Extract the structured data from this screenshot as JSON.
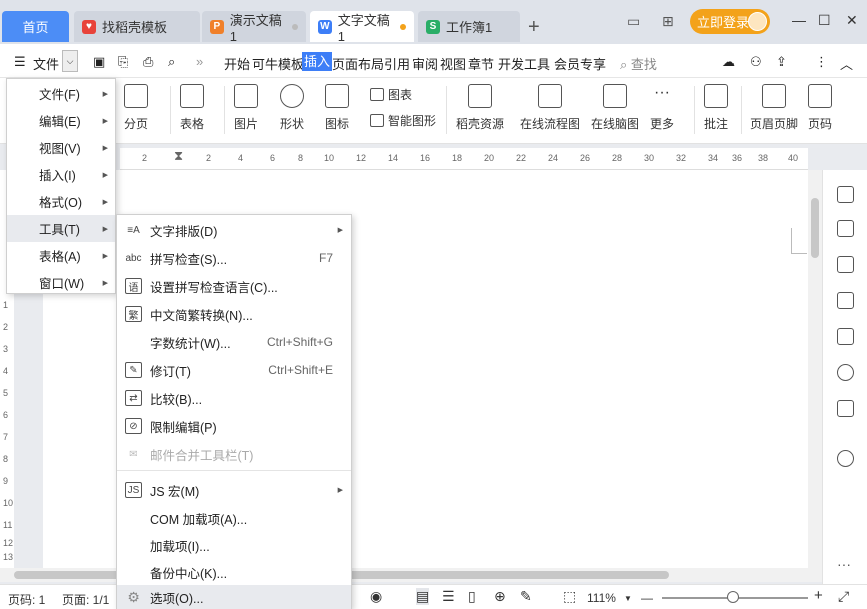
{
  "tabs": {
    "home": "首页",
    "items": [
      {
        "label": "找稻壳模板",
        "icon_letter": "",
        "color": "#e8433a"
      },
      {
        "label": "演示文稿1",
        "icon_letter": "P",
        "color": "#f0802a"
      },
      {
        "label": "文字文稿1",
        "icon_letter": "W",
        "color": "#3d7ef7"
      },
      {
        "label": "工作簿1",
        "icon_letter": "S",
        "color": "#2aae67"
      }
    ],
    "add": "+"
  },
  "login": {
    "label": "立即登录"
  },
  "window": {
    "minimize": "—",
    "maximize": "☐",
    "close": "✕"
  },
  "menubar": {
    "file": "文件",
    "items": [
      "开始",
      "可牛模板",
      "插入",
      "页面布局",
      "引用",
      "审阅",
      "视图",
      "章节",
      "开发工具",
      "会员专享"
    ],
    "search": "查找"
  },
  "ribbon": {
    "page_split": "分页",
    "table": "表格",
    "picture": "图片",
    "shape": "形状",
    "icons": "图标",
    "chart": "图表",
    "smart_shape": "智能图形",
    "docer": "稻壳资源",
    "flowchart": "在线流程图",
    "mindmap": "在线脑图",
    "more": "更多",
    "comment": "批注",
    "header_footer": "页眉页脚",
    "page_num": "页码"
  },
  "ruler": {
    "h_ticks": [
      "2",
      "2",
      "4",
      "6",
      "8",
      "10",
      "12",
      "14",
      "16",
      "18",
      "20",
      "22",
      "24",
      "26",
      "28",
      "30",
      "32",
      "34",
      "36",
      "38",
      "40"
    ],
    "v_ticks": [
      "1",
      "2",
      "3",
      "4",
      "5",
      "6",
      "7",
      "8",
      "9",
      "10",
      "11",
      "12",
      "13"
    ]
  },
  "menu1": [
    {
      "label": "文件(F)"
    },
    {
      "label": "编辑(E)"
    },
    {
      "label": "视图(V)"
    },
    {
      "label": "插入(I)"
    },
    {
      "label": "格式(O)"
    },
    {
      "label": "工具(T)"
    },
    {
      "label": "表格(A)"
    },
    {
      "label": "窗口(W)"
    }
  ],
  "menu2": [
    {
      "label": "文字排版(D)",
      "shortcut": "",
      "icon": "≡A"
    },
    {
      "label": "拼写检查(S)...",
      "shortcut": "F7",
      "icon": "abc"
    },
    {
      "label": "设置拼写检查语言(C)...",
      "shortcut": "",
      "icon": "语"
    },
    {
      "label": "中文简繁转换(N)...",
      "shortcut": "",
      "icon": "繁"
    },
    {
      "label": "字数统计(W)...",
      "shortcut": "Ctrl+Shift+G",
      "icon": ""
    },
    {
      "label": "修订(T)",
      "shortcut": "Ctrl+Shift+E",
      "icon": "✎"
    },
    {
      "label": "比较(B)...",
      "shortcut": "",
      "icon": "⇄"
    },
    {
      "label": "限制编辑(P)",
      "shortcut": "",
      "icon": "⊘"
    },
    {
      "label": "邮件合并工具栏(T)",
      "shortcut": "",
      "icon": "✉"
    },
    {
      "label": "JS 宏(M)",
      "shortcut": "",
      "icon": "JS"
    },
    {
      "label": "COM 加载项(A)...",
      "shortcut": "",
      "icon": ""
    },
    {
      "label": "加载项(I)...",
      "shortcut": "",
      "icon": ""
    },
    {
      "label": "备份中心(K)...",
      "shortcut": "",
      "icon": ""
    },
    {
      "label": "选项(O)...",
      "shortcut": "",
      "icon": "⚙"
    }
  ],
  "status": {
    "page_no": "页码: 1",
    "pages": "页面: 1/1",
    "zoom": "111%",
    "zoom_minus": "—",
    "zoom_plus": "+",
    "zoom_level": 0.45
  }
}
